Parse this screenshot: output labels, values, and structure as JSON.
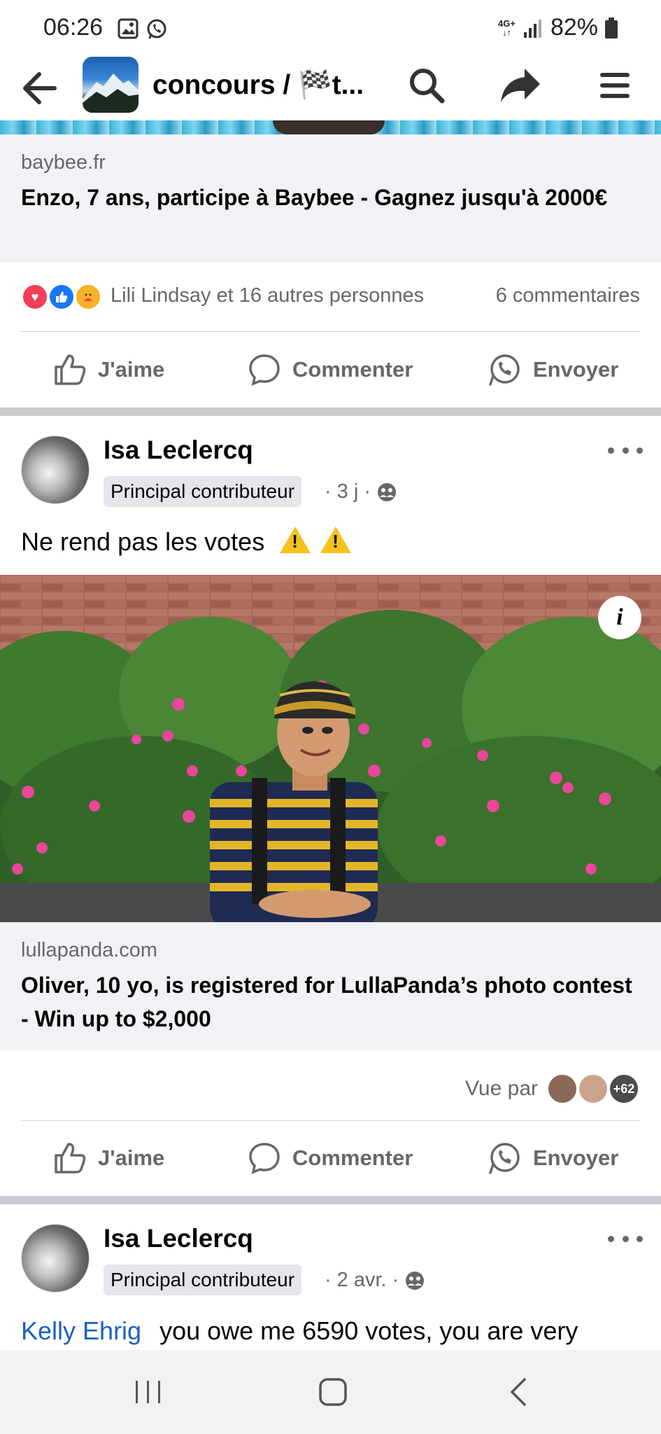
{
  "status_bar": {
    "time": "06:26",
    "network": "4G+",
    "battery": "82%"
  },
  "header": {
    "title": "concours / 🏁t..."
  },
  "post1": {
    "link_domain": "baybee.fr",
    "link_title": "Enzo, 7 ans, participe à Baybee - Gagnez jusqu'à 2000€",
    "reactions_text": "Lili Lindsay et 16 autres personnes",
    "comments": "6 commentaires"
  },
  "actions": {
    "like": "J'aime",
    "comment": "Commenter",
    "send": "Envoyer"
  },
  "post2": {
    "author": "Isa Leclercq",
    "badge": "Principal contributeur",
    "time": "3 j",
    "text": "Ne rend pas les votes",
    "info_label": "i",
    "link_domain": "lullapanda.com",
    "link_title": "Oliver, 10 yo, is registered for LullaPanda’s photo contest - Win up to $2,000",
    "seen_by_label": "Vue par",
    "seen_more": "+62"
  },
  "post3": {
    "author": "Isa Leclercq",
    "badge": "Principal contributeur",
    "time": "2 avr.",
    "mention": "Kelly Ehrig",
    "text": "you owe me 6590 votes, you are very"
  },
  "colors": {
    "accent_blue": "#1b5fc4",
    "text_secondary": "#65676b",
    "link_bg": "#f0f2f5"
  }
}
